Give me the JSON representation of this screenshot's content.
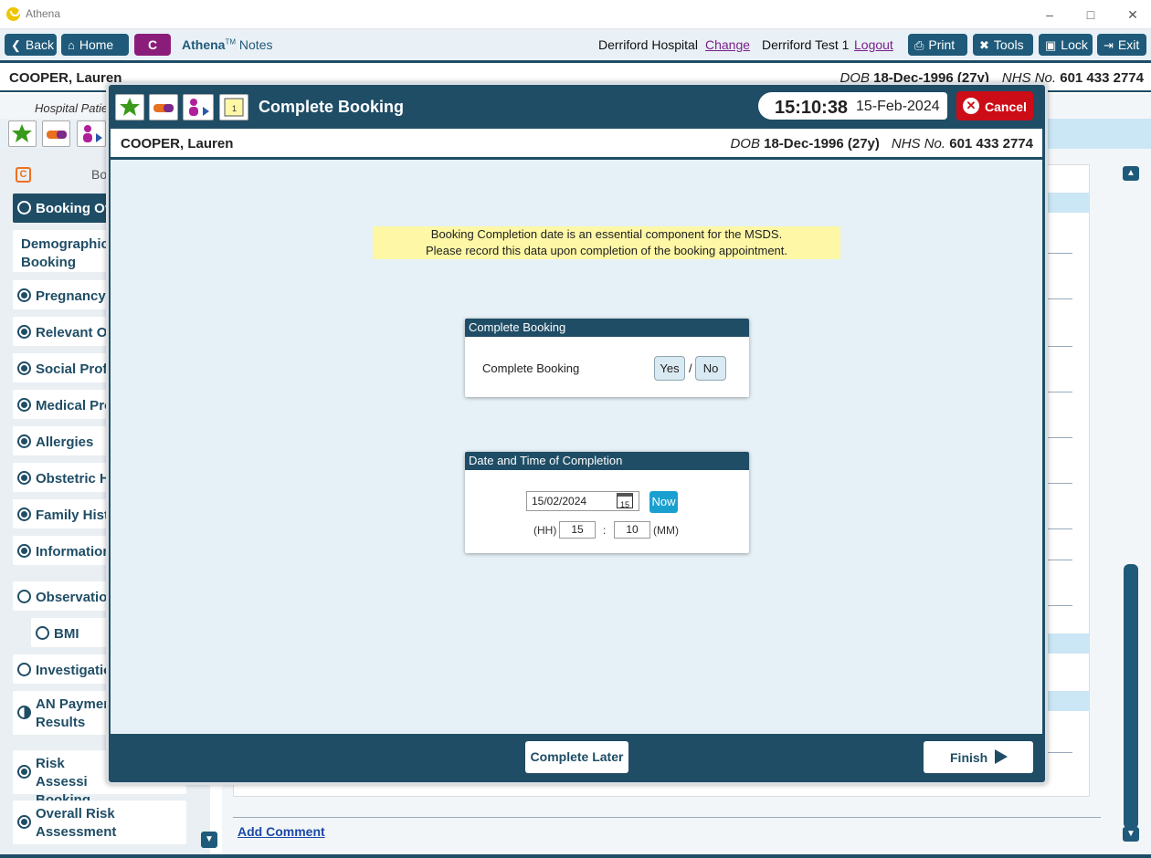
{
  "window": {
    "title": "Athena"
  },
  "toolbar": {
    "back": "Back",
    "home": "Home",
    "c_badge": "C",
    "app_name": "Athena",
    "app_tm": "TM",
    "app_sub": "Notes",
    "hospital": "Derriford Hospital",
    "change": "Change",
    "user": "Derriford Test 1",
    "logout": "Logout",
    "print": "Print",
    "tools": "Tools",
    "lock": "Lock",
    "exit": "Exit"
  },
  "patient": {
    "name": "COOPER, Lauren",
    "dob_label": "DOB",
    "dob": "18-Dec-1996 (27y)",
    "nhs_label": "NHS No.",
    "nhs": "601 433 2774"
  },
  "hospital_patient": "Hospital Patie",
  "sidebar": {
    "header": "Bo",
    "items": [
      {
        "label": "Booking Ov"
      },
      {
        "label": "Demographics Booking"
      },
      {
        "label": "Pregnancy I"
      },
      {
        "label": "Relevant Ot"
      },
      {
        "label": "Social Profil"
      },
      {
        "label": "Medical Pro"
      },
      {
        "label": "Allergies"
      },
      {
        "label": "Obstetric H"
      },
      {
        "label": "Family Histo"
      },
      {
        "label": "Information"
      },
      {
        "label": "Observation"
      },
      {
        "label": "BMI"
      },
      {
        "label": "Investigatio"
      },
      {
        "label": "AN Paymen Results"
      },
      {
        "label": "Risk Assessi Booking"
      },
      {
        "label": "Overall Risk Assessment"
      }
    ]
  },
  "main": {
    "add_comment": "Add Comment"
  },
  "modal": {
    "title": "Complete Booking",
    "time": "15:10:38",
    "date": "15-Feb-2024",
    "cancel": "Cancel",
    "notice_line1": "Booking Completion date is an essential component for the MSDS.",
    "notice_line2": "Please record this data upon completion of the booking appointment.",
    "complete_card": {
      "header": "Complete Booking",
      "label": "Complete Booking",
      "yes": "Yes",
      "slash": "/",
      "no": "No"
    },
    "datetime_card": {
      "header": "Date and Time of Completion",
      "date_value": "15/02/2024",
      "cal_day": "15",
      "now": "Now",
      "hh_label": "(HH)",
      "hh": "15",
      "colon": ":",
      "mm": "10",
      "mm_label": "(MM)"
    },
    "complete_later": "Complete Later",
    "finish": "Finish"
  }
}
